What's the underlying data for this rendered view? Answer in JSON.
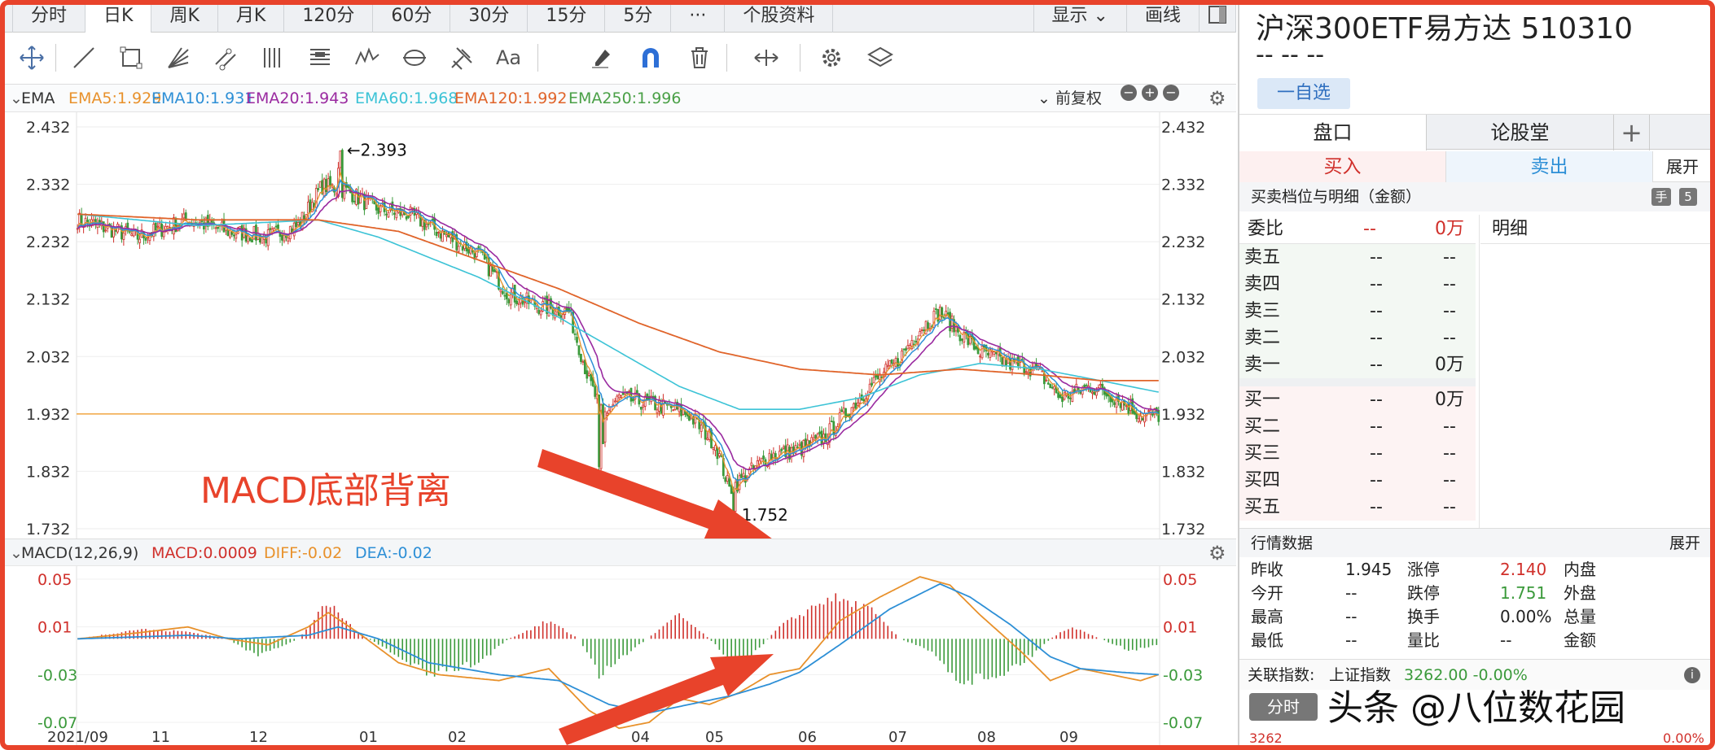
{
  "tabs": [
    "分时",
    "日K",
    "周K",
    "月K",
    "120分",
    "60分",
    "30分",
    "15分",
    "5分",
    "···",
    "个股资料",
    "显示",
    "画线"
  ],
  "active_tab": "日K",
  "main_chart": {
    "indicator": "EMA",
    "legend": [
      {
        "label": "EMA5:1.929",
        "color": "#e8912b"
      },
      {
        "label": "EMA10:1.931",
        "color": "#2d8fd6"
      },
      {
        "label": "EMA20:1.943",
        "color": "#9a2aa0"
      },
      {
        "label": "EMA60:1.968",
        "color": "#3cc3d6"
      },
      {
        "label": "EMA120:1.992",
        "color": "#e0642a"
      },
      {
        "label": "EMA250:1.996",
        "color": "#4aa047"
      }
    ],
    "adjust": "前复权",
    "y_ticks": [
      "2.432",
      "2.332",
      "2.232",
      "2.132",
      "2.032",
      "1.932",
      "1.832",
      "1.732"
    ],
    "high_label": "←2.393",
    "low_label": "1.752",
    "annotation": "MACD底部背离"
  },
  "sub_chart": {
    "indicator": "MACD(12,26,9)",
    "macd_label": "MACD:0.0009",
    "diff_label": "DIFF:-0.02",
    "dea_label": "DEA:-0.02",
    "y_ticks": [
      "0.05",
      "0.01",
      "-0.03",
      "-0.07"
    ],
    "x_ticks": [
      "2021/09",
      "11",
      "12",
      "01",
      "02",
      "04",
      "05",
      "06",
      "07",
      "08",
      "09"
    ]
  },
  "chart_data": {
    "type": "candlestick",
    "price_range": [
      1.732,
      2.432
    ],
    "macd_range": [
      -0.07,
      0.05
    ],
    "reference_line": 1.932,
    "close_key": [
      [
        0,
        2.27
      ],
      [
        30,
        2.24
      ],
      [
        55,
        2.27
      ],
      [
        75,
        2.25
      ],
      [
        95,
        2.24
      ],
      [
        110,
        2.26
      ],
      [
        122,
        2.33
      ],
      [
        135,
        2.32
      ],
      [
        148,
        2.29
      ],
      [
        165,
        2.28
      ],
      [
        180,
        2.25
      ],
      [
        200,
        2.21
      ],
      [
        215,
        2.14
      ],
      [
        230,
        2.12
      ],
      [
        245,
        2.11
      ],
      [
        255,
        1.99
      ],
      [
        262,
        1.93
      ],
      [
        270,
        1.96
      ],
      [
        285,
        1.95
      ],
      [
        298,
        1.94
      ],
      [
        305,
        1.93
      ],
      [
        318,
        1.88
      ],
      [
        325,
        1.8
      ],
      [
        335,
        1.83
      ],
      [
        345,
        1.86
      ],
      [
        360,
        1.87
      ],
      [
        372,
        1.89
      ],
      [
        385,
        1.94
      ],
      [
        395,
        1.98
      ],
      [
        408,
        2.02
      ],
      [
        420,
        2.08
      ],
      [
        430,
        2.11
      ],
      [
        438,
        2.08
      ],
      [
        450,
        2.04
      ],
      [
        465,
        2.02
      ],
      [
        478,
        2.01
      ],
      [
        490,
        1.96
      ],
      [
        505,
        1.98
      ],
      [
        518,
        1.96
      ],
      [
        530,
        1.93
      ],
      [
        539,
        1.93
      ]
    ],
    "ema60_key": [
      [
        0,
        2.28
      ],
      [
        60,
        2.26
      ],
      [
        120,
        2.27
      ],
      [
        150,
        2.24
      ],
      [
        200,
        2.17
      ],
      [
        240,
        2.1
      ],
      [
        270,
        2.04
      ],
      [
        300,
        1.98
      ],
      [
        330,
        1.94
      ],
      [
        360,
        1.94
      ],
      [
        390,
        1.96
      ],
      [
        420,
        2.0
      ],
      [
        450,
        2.02
      ],
      [
        480,
        2.01
      ],
      [
        510,
        1.99
      ],
      [
        539,
        1.97
      ]
    ],
    "ema120_key": [
      [
        0,
        2.28
      ],
      [
        60,
        2.27
      ],
      [
        120,
        2.27
      ],
      [
        160,
        2.25
      ],
      [
        200,
        2.2
      ],
      [
        240,
        2.15
      ],
      [
        280,
        2.09
      ],
      [
        320,
        2.04
      ],
      [
        360,
        2.01
      ],
      [
        400,
        2.0
      ],
      [
        440,
        2.01
      ],
      [
        480,
        2.0
      ],
      [
        510,
        1.99
      ],
      [
        539,
        1.99
      ]
    ],
    "macd_hist_key": [
      [
        0,
        0.0
      ],
      [
        30,
        0.008
      ],
      [
        55,
        0.006
      ],
      [
        75,
        0.0
      ],
      [
        90,
        -0.015
      ],
      [
        110,
        0.0
      ],
      [
        125,
        0.03
      ],
      [
        140,
        0.005
      ],
      [
        155,
        -0.01
      ],
      [
        175,
        -0.03
      ],
      [
        200,
        -0.02
      ],
      [
        215,
        0.0
      ],
      [
        235,
        0.015
      ],
      [
        250,
        0.0
      ],
      [
        260,
        -0.03
      ],
      [
        280,
        -0.005
      ],
      [
        300,
        0.02
      ],
      [
        315,
        0.0
      ],
      [
        330,
        -0.025
      ],
      [
        350,
        0.01
      ],
      [
        375,
        0.035
      ],
      [
        395,
        0.025
      ],
      [
        410,
        0.0
      ],
      [
        425,
        -0.01
      ],
      [
        440,
        -0.035
      ],
      [
        460,
        -0.03
      ],
      [
        475,
        -0.015
      ],
      [
        485,
        0.0
      ],
      [
        495,
        0.01
      ],
      [
        510,
        0.0
      ],
      [
        525,
        -0.01
      ],
      [
        539,
        -0.005
      ]
    ],
    "diff_key": [
      [
        0,
        0.0
      ],
      [
        30,
        0.005
      ],
      [
        55,
        0.01
      ],
      [
        75,
        0.0
      ],
      [
        95,
        -0.005
      ],
      [
        115,
        0.01
      ],
      [
        125,
        0.022
      ],
      [
        140,
        0.005
      ],
      [
        160,
        -0.02
      ],
      [
        180,
        -0.03
      ],
      [
        210,
        -0.035
      ],
      [
        235,
        -0.025
      ],
      [
        255,
        -0.06
      ],
      [
        270,
        -0.075
      ],
      [
        285,
        -0.07
      ],
      [
        300,
        -0.05
      ],
      [
        315,
        -0.055
      ],
      [
        330,
        -0.045
      ],
      [
        345,
        -0.03
      ],
      [
        360,
        -0.025
      ],
      [
        380,
        0.015
      ],
      [
        400,
        0.035
      ],
      [
        420,
        0.052
      ],
      [
        435,
        0.045
      ],
      [
        450,
        0.02
      ],
      [
        470,
        -0.01
      ],
      [
        485,
        -0.035
      ],
      [
        500,
        -0.025
      ],
      [
        515,
        -0.03
      ],
      [
        530,
        -0.035
      ],
      [
        539,
        -0.03
      ]
    ],
    "dea_key": [
      [
        0,
        0.0
      ],
      [
        55,
        0.003
      ],
      [
        80,
        0.0
      ],
      [
        115,
        0.003
      ],
      [
        130,
        0.01
      ],
      [
        150,
        0.0
      ],
      [
        175,
        -0.02
      ],
      [
        210,
        -0.03
      ],
      [
        240,
        -0.035
      ],
      [
        265,
        -0.055
      ],
      [
        285,
        -0.062
      ],
      [
        305,
        -0.055
      ],
      [
        325,
        -0.048
      ],
      [
        345,
        -0.038
      ],
      [
        360,
        -0.028
      ],
      [
        380,
        -0.005
      ],
      [
        405,
        0.025
      ],
      [
        430,
        0.046
      ],
      [
        445,
        0.035
      ],
      [
        465,
        0.012
      ],
      [
        485,
        -0.015
      ],
      [
        500,
        -0.025
      ],
      [
        520,
        -0.028
      ],
      [
        539,
        -0.03
      ]
    ]
  },
  "right_panel": {
    "title": "沪深300ETF易方达  510310",
    "price": "-- -- --",
    "self_select": "一自选",
    "tab_pankou": "盘口",
    "tab_lungutang": "论股堂",
    "plus": "+",
    "buy": "买入",
    "sell": "卖出",
    "expand": "展开",
    "ob_title": "买卖档位与明细（金额）",
    "ob_badge1": "手",
    "ob_badge2": "5",
    "weibi_label": "委比",
    "weibi_mid": "--",
    "weibi_val": "0万",
    "mingxi": "明细",
    "asks": [
      {
        "label": "卖五",
        "price": "--",
        "vol": "--"
      },
      {
        "label": "卖四",
        "price": "--",
        "vol": "--"
      },
      {
        "label": "卖三",
        "price": "--",
        "vol": "--"
      },
      {
        "label": "卖二",
        "price": "--",
        "vol": "--"
      },
      {
        "label": "卖一",
        "price": "--",
        "vol": "0万"
      }
    ],
    "bids": [
      {
        "label": "买一",
        "price": "--",
        "vol": "0万"
      },
      {
        "label": "买二",
        "price": "--",
        "vol": "--"
      },
      {
        "label": "买三",
        "price": "--",
        "vol": "--"
      },
      {
        "label": "买四",
        "price": "--",
        "vol": "--"
      },
      {
        "label": "买五",
        "price": "--",
        "vol": "--"
      }
    ],
    "md_title": "行情数据",
    "md_expand": "展开",
    "market_data": [
      [
        {
          "k": "昨收",
          "v": "1.945",
          "c": "#222"
        },
        {
          "k": "涨停",
          "v": "2.140",
          "c": "#d0302b"
        },
        {
          "k": "内盘",
          "v": ""
        }
      ],
      [
        {
          "k": "今开",
          "v": "--",
          "c": "#222"
        },
        {
          "k": "跌停",
          "v": "1.751",
          "c": "#3b9a3b"
        },
        {
          "k": "外盘",
          "v": ""
        }
      ],
      [
        {
          "k": "最高",
          "v": "--",
          "c": "#222"
        },
        {
          "k": "换手",
          "v": "0.00%",
          "c": "#222"
        },
        {
          "k": "总量",
          "v": ""
        }
      ],
      [
        {
          "k": "最低",
          "v": "--",
          "c": "#222"
        },
        {
          "k": "量比",
          "v": "--",
          "c": "#222"
        },
        {
          "k": "金额",
          "v": ""
        }
      ]
    ],
    "related_label": "关联指数:",
    "related_name": "上证指数",
    "related_value": "3262.00 -0.00%",
    "fenshi": "分时",
    "bottom_left": "3262",
    "bottom_right": "0.00%"
  },
  "watermark": "头条 @八位数花园",
  "colors": {
    "up": "#d0302b",
    "down": "#3b9a3b",
    "ref_line": "#f0a640",
    "arrow": "#e8432b"
  }
}
